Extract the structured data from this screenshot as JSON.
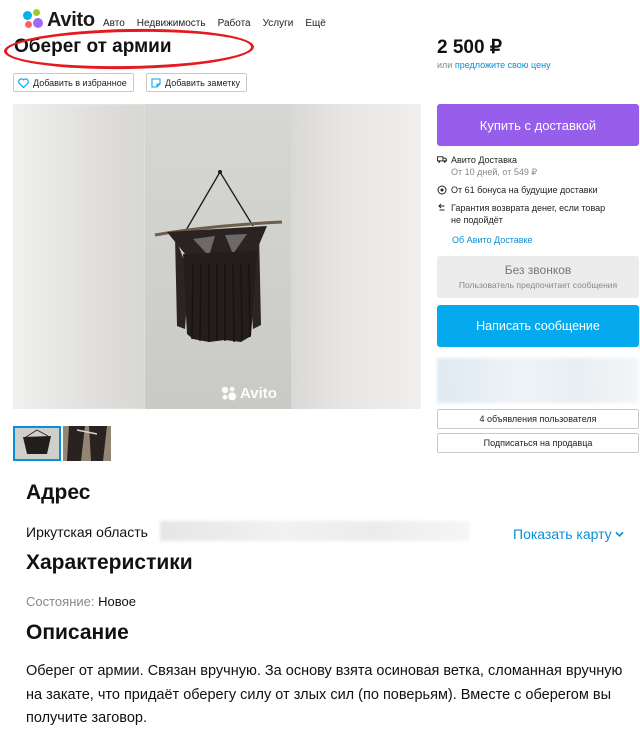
{
  "header": {
    "logo_text": "Avito",
    "nav": [
      "Авто",
      "Недвижимость",
      "Работа",
      "Услуги",
      "Ещё"
    ]
  },
  "listing": {
    "title": "Оберег от армии",
    "price": "2 500 ₽",
    "price_or": "или",
    "price_offer_link": "предложите свою цену",
    "actions": {
      "favorite": "Добавить в избранное",
      "note": "Добавить заметку"
    },
    "watermark": "Avito"
  },
  "sidebar": {
    "buy_button": "Купить с доставкой",
    "delivery_title": "Авито Доставка",
    "delivery_sub": "От 10 дней, от 549 ₽",
    "bonus": "От 61 бонуса на будущие доставки",
    "guarantee_line1": "Гарантия возврата денег, если товар",
    "guarantee_line2": "не подойдёт",
    "about_delivery_link": "Об Авито Доставке",
    "no_calls_title": "Без звонков",
    "no_calls_sub": "Пользователь предпочитает сообщения",
    "message_button": "Написать сообщение",
    "user_ads_button": "4 объявления пользователя",
    "subscribe_button": "Подписаться на продавца"
  },
  "address": {
    "heading": "Адрес",
    "region": "Иркутская область",
    "show_map": "Показать карту"
  },
  "characteristics": {
    "heading": "Характеристики",
    "condition_label": "Состояние:",
    "condition_value": "Новое"
  },
  "description": {
    "heading": "Описание",
    "text": "Оберег от армии. Связан вручную. За основу взята осиновая ветка, сломанная вручную на закате, что придаёт оберегу силу от злых сил (по поверьям). Вместе с оберегом вы получите заговор."
  },
  "colors": {
    "brand_purple": "#965eeb",
    "brand_blue": "#05a9ee",
    "link_blue": "#0a8fd6",
    "annotation_red": "#e5191e"
  }
}
